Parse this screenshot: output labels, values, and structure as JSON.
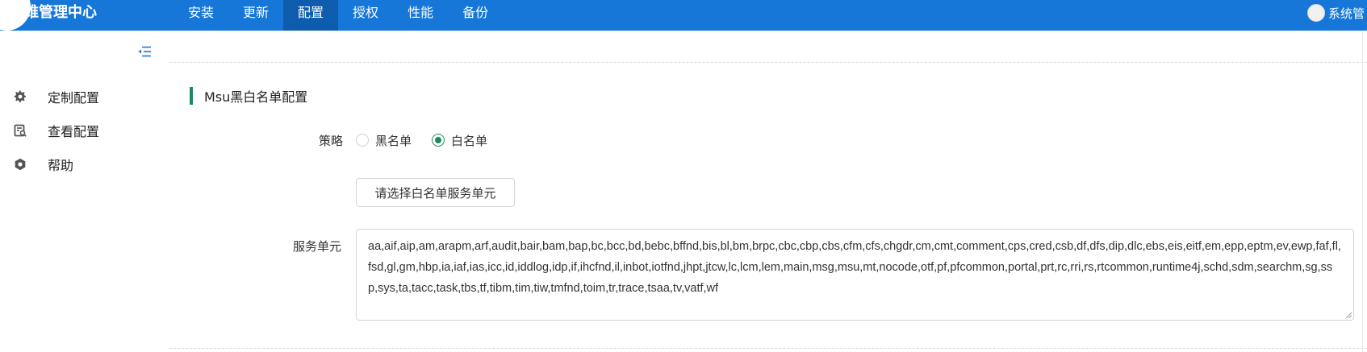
{
  "header": {
    "title": "维管理中心",
    "nav": [
      {
        "label": "安装",
        "active": false
      },
      {
        "label": "更新",
        "active": false
      },
      {
        "label": "配置",
        "active": true
      },
      {
        "label": "授权",
        "active": false
      },
      {
        "label": "性能",
        "active": false
      },
      {
        "label": "备份",
        "active": false
      }
    ],
    "user": {
      "name": "系统管"
    }
  },
  "sidebar": {
    "collapse_icon": "menu-fold-icon",
    "items": [
      {
        "label": "定制配置",
        "icon": "gear-icon"
      },
      {
        "label": "查看配置",
        "icon": "document-search-icon"
      },
      {
        "label": "帮助",
        "icon": "help-hexagon-icon"
      }
    ]
  },
  "main": {
    "section_title": "Msu黑白名单配置",
    "strategy": {
      "label": "策略",
      "options": [
        {
          "label": "黑名单",
          "checked": false
        },
        {
          "label": "白名单",
          "checked": true
        }
      ]
    },
    "select_button": "请选择白名单服务单元",
    "units": {
      "label": "服务单元",
      "value": "aa,aif,aip,am,arapm,arf,audit,bair,bam,bap,bc,bcc,bd,bebc,bffnd,bis,bl,bm,brpc,cbc,cbp,cbs,cfm,cfs,chgdr,cm,cmt,comment,cps,cred,csb,df,dfs,dip,dlc,ebs,eis,eitf,em,epp,eptm,ev,ewp,faf,fl,fsd,gl,gm,hbp,ia,iaf,ias,icc,id,iddlog,idp,if,ihcfnd,il,inbot,iotfnd,jhpt,jtcw,lc,lcm,lem,main,msg,msu,mt,nocode,otf,pf,pfcommon,portal,prt,rc,rri,rs,rtcommon,runtime4j,schd,sdm,searchm,sg,ssp,sys,ta,tacc,task,tbs,tf,tibm,tim,tiw,tmfnd,toim,tr,trace,tsaa,tv,vatf,wf"
    }
  },
  "colors": {
    "navbar": "#1677d9",
    "nav_active": "#0d5cad",
    "accent": "#1c8a5a"
  }
}
